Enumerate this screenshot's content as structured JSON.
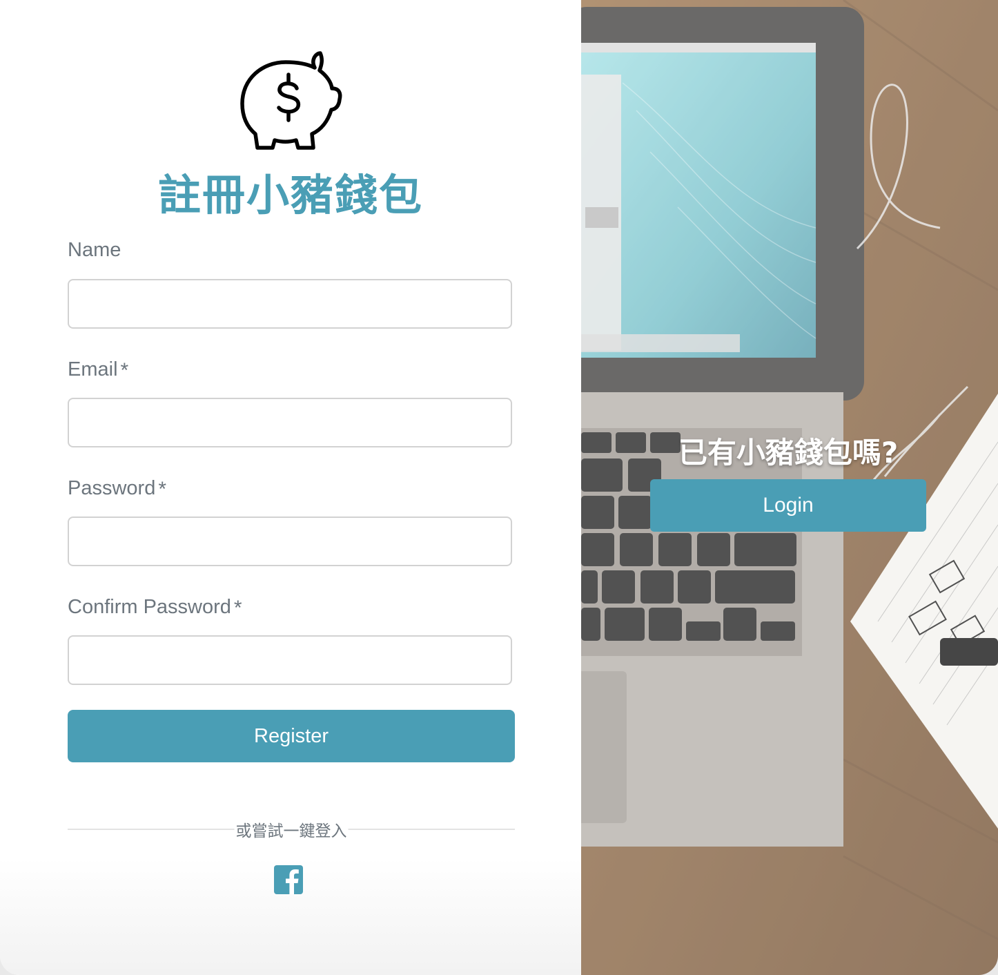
{
  "colors": {
    "accent": "#4a9eb5",
    "label": "#6c757d",
    "input_border": "#d2d2d2"
  },
  "register": {
    "title": "註冊小豬錢包",
    "logo_icon": "piggy-bank-dollar-icon",
    "fields": [
      {
        "label": "Name",
        "required": false,
        "value": "",
        "placeholder": ""
      },
      {
        "label": "Email",
        "required": true,
        "value": "",
        "placeholder": ""
      },
      {
        "label": "Password",
        "required": true,
        "value": "",
        "placeholder": ""
      },
      {
        "label": "Confirm Password",
        "required": true,
        "value": "",
        "placeholder": ""
      }
    ],
    "required_mark": "*",
    "submit_label": "Register",
    "alt_login_text": "或嘗試一鍵登入",
    "social_icon": "facebook-icon"
  },
  "login_panel": {
    "question": "已有小豬錢包嗎?",
    "button_label": "Login"
  }
}
